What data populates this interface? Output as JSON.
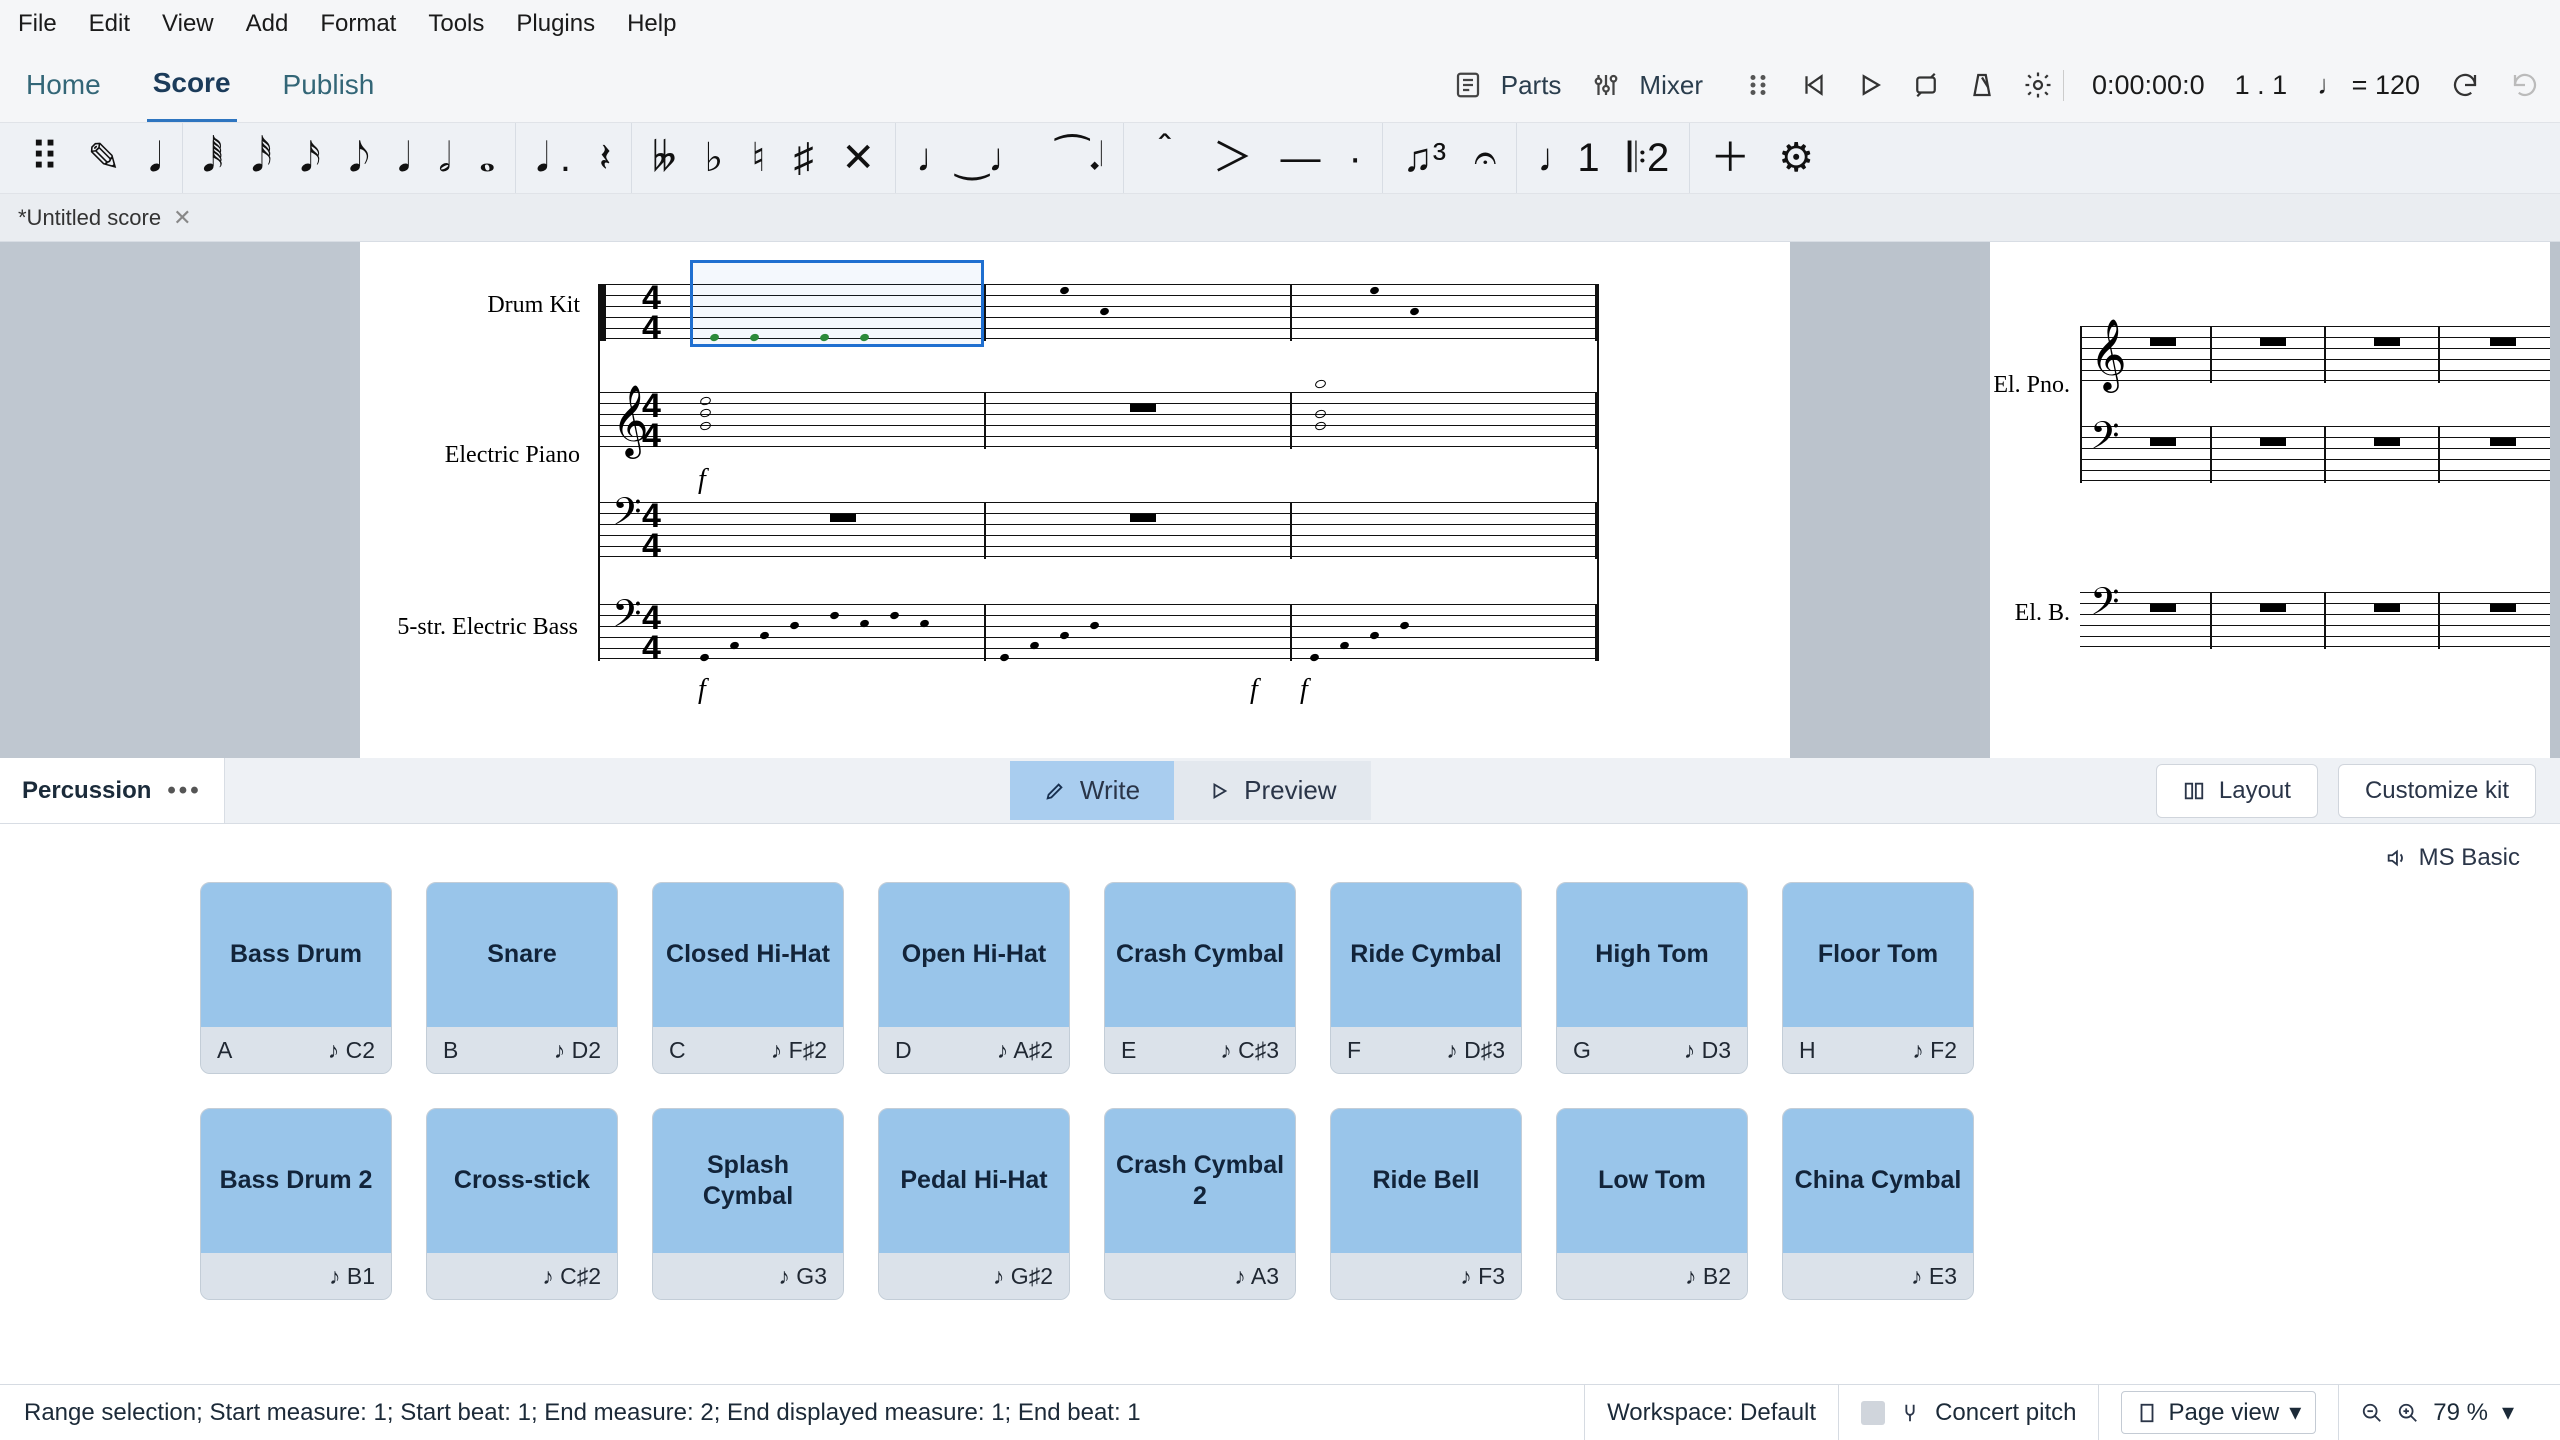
{
  "menu": [
    "File",
    "Edit",
    "View",
    "Add",
    "Format",
    "Tools",
    "Plugins",
    "Help"
  ],
  "main_tabs": {
    "home": "Home",
    "score": "Score",
    "publish": "Publish",
    "active": "score"
  },
  "top_buttons": {
    "parts": "Parts",
    "mixer": "Mixer"
  },
  "transport": {
    "time": "0:00:00:0",
    "bars_beats": "1 . 1",
    "tempo_glyph": "♩ =",
    "tempo": "120"
  },
  "doc_tab": {
    "title": "*Untitled score"
  },
  "instruments": {
    "drumkit": "Drum Kit",
    "epiano": "Electric Piano",
    "bass": "5-str. Electric Bass",
    "elpno_short": "El. Pno.",
    "elb_short": "El. B."
  },
  "time_signature": {
    "num": "4",
    "den": "4"
  },
  "dynamics": {
    "f": "f"
  },
  "perc_panel": {
    "title": "Percussion",
    "write": "Write",
    "preview": "Preview",
    "layout": "Layout",
    "customize": "Customize kit",
    "soundfont": "MS Basic"
  },
  "pads": [
    {
      "name": "Bass Drum",
      "key": "A",
      "note": "C2"
    },
    {
      "name": "Snare",
      "key": "B",
      "note": "D2"
    },
    {
      "name": "Closed Hi-Hat",
      "key": "C",
      "note": "F♯2"
    },
    {
      "name": "Open Hi-Hat",
      "key": "D",
      "note": "A♯2"
    },
    {
      "name": "Crash Cymbal",
      "key": "E",
      "note": "C♯3"
    },
    {
      "name": "Ride Cymbal",
      "key": "F",
      "note": "D♯3"
    },
    {
      "name": "High Tom",
      "key": "G",
      "note": "D3"
    },
    {
      "name": "Floor Tom",
      "key": "H",
      "note": "F2"
    },
    {
      "name": "Bass Drum 2",
      "key": "",
      "note": "B1"
    },
    {
      "name": "Cross-stick",
      "key": "",
      "note": "C♯2"
    },
    {
      "name": "Splash Cymbal",
      "key": "",
      "note": "G3"
    },
    {
      "name": "Pedal Hi-Hat",
      "key": "",
      "note": "G♯2"
    },
    {
      "name": "Crash Cymbal 2",
      "key": "",
      "note": "A3"
    },
    {
      "name": "Ride Bell",
      "key": "",
      "note": "F3"
    },
    {
      "name": "Low Tom",
      "key": "",
      "note": "B2"
    },
    {
      "name": "China Cymbal",
      "key": "",
      "note": "E3"
    }
  ],
  "status": {
    "selection": "Range selection; Start measure: 1; Start beat: 1; End measure: 2; End displayed measure: 1; End beat: 1",
    "workspace": "Workspace: Default",
    "concert_pitch": "Concert pitch",
    "view_mode": "Page view",
    "zoom": "79 %"
  },
  "note_toolbar_groups": [
    [
      "⠿",
      "✎",
      "𝅘𝅥"
    ],
    [
      "𝅘𝅥𝅱",
      "𝅘𝅥𝅰",
      "𝅘𝅥𝅯",
      "𝅘𝅥𝅮",
      "𝅘𝅥",
      "𝅗𝅥",
      "𝅝"
    ],
    [
      "𝅘𝅥 .",
      "𝄽"
    ],
    [
      "𝄫",
      "♭",
      "♮",
      "♯",
      "✕"
    ],
    [
      "♩‿♩",
      "⁀𝆺𝅥"
    ],
    [
      "＾",
      "＞",
      "—",
      "·"
    ],
    [
      "♫³",
      "𝄐"
    ],
    [
      "♩1",
      "𝄆2"
    ],
    [
      "＋",
      "⚙"
    ]
  ]
}
